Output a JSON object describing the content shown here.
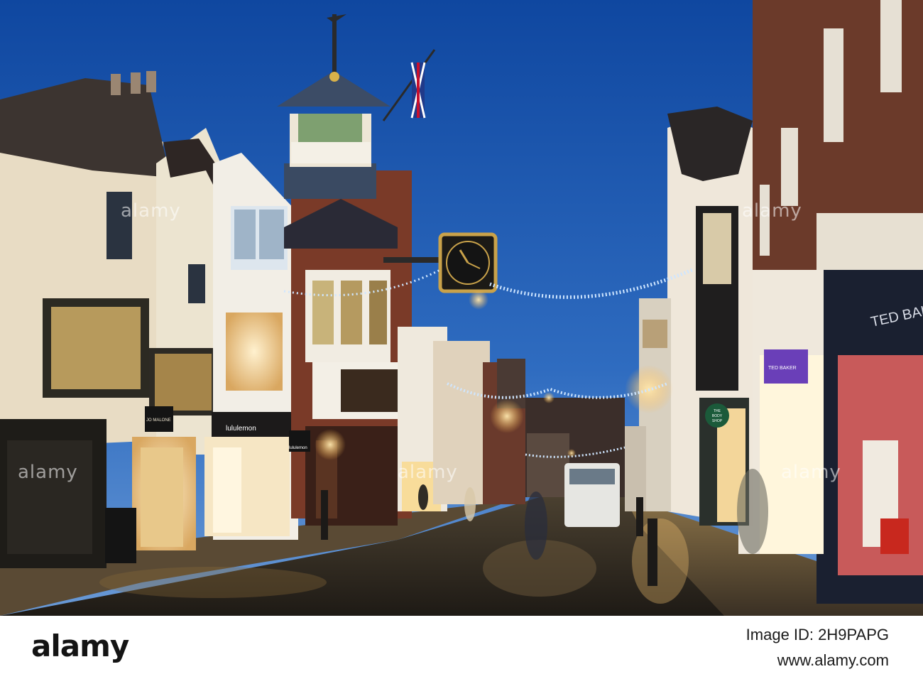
{
  "photo": {
    "subject": "street",
    "colors": {
      "sky": "#1f5aa8",
      "sky_low": "#5c8fd2",
      "lamp": "#ffd98a",
      "cobbles": "#2a2620"
    }
  },
  "signs": {
    "jo_malone": "JO MALONE",
    "lululemon_a": "lululemon",
    "lululemon_b": "lululemon",
    "ted_baker_shop": "TED BAKER",
    "ted_baker_flag": "TED BAKER",
    "body_shop_line1": "THE",
    "body_shop_line2": "BODY",
    "body_shop_line3": "SHOP"
  },
  "watermark": {
    "text": "alamy"
  },
  "footer": {
    "logo": "alamy",
    "image_id": "Image ID: 2H9PAPG",
    "url": "www.alamy.com"
  }
}
